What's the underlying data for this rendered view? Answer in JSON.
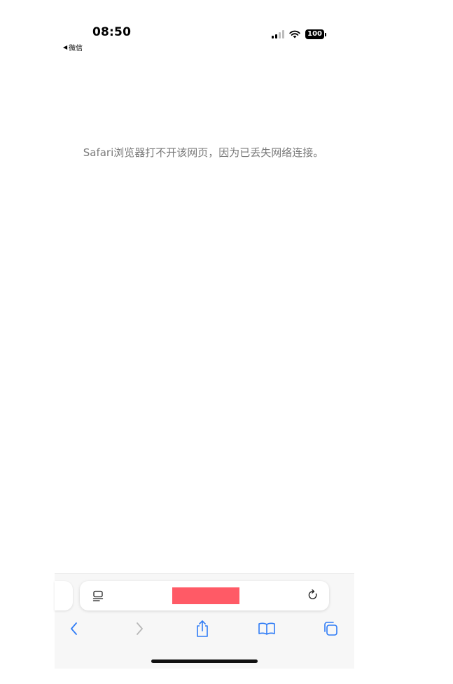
{
  "status_bar": {
    "time": "08:50",
    "back_app": "微信",
    "battery": "100"
  },
  "page": {
    "error_message": "Safari浏览器打不开该网页，因为已丢失网络连接。"
  },
  "address_bar": {
    "url_redacted_color": "#ff5a66"
  },
  "toolbar": {
    "icons": [
      "back-icon",
      "forward-icon",
      "share-icon",
      "bookmarks-icon",
      "tabs-icon"
    ],
    "accent": "#2f7cf6",
    "disabled": "#b8b8b8"
  }
}
